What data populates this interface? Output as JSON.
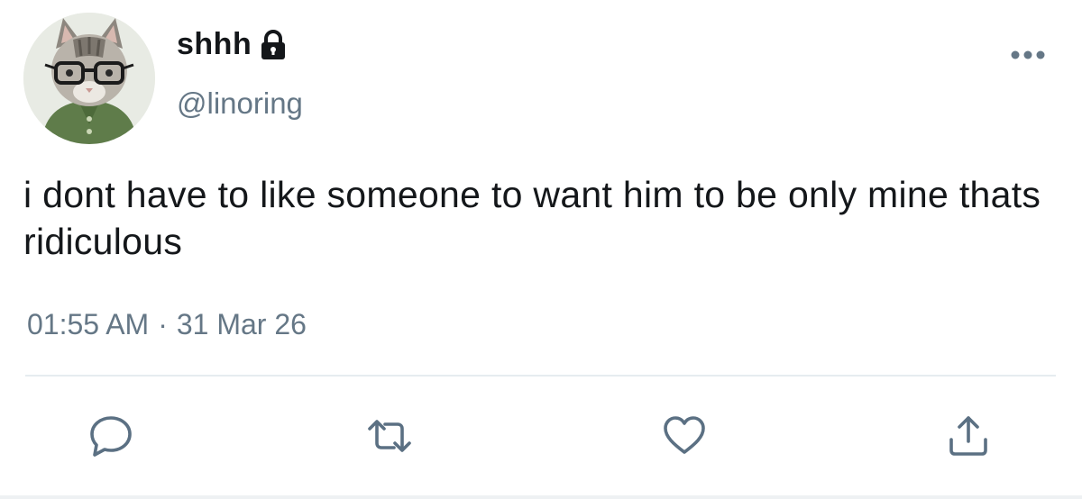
{
  "user": {
    "display_name": "shhh",
    "handle": "@linoring",
    "avatar_icon": "cat-with-glasses-avatar",
    "protected_icon": "lock-icon"
  },
  "tweet": {
    "text": "i dont have to like someone to want him to be only mine thats ridiculous",
    "time": "01:55 AM",
    "separator": "·",
    "date": "31 Mar 26"
  },
  "actions": [
    {
      "name": "reply",
      "icon": "reply-icon"
    },
    {
      "name": "retweet",
      "icon": "retweet-icon"
    },
    {
      "name": "like",
      "icon": "heart-icon"
    },
    {
      "name": "share",
      "icon": "share-icon"
    }
  ],
  "colors": {
    "text": "#14171a",
    "secondary": "#657786",
    "icon": "#5b7083",
    "divider": "#e6ecf0"
  }
}
